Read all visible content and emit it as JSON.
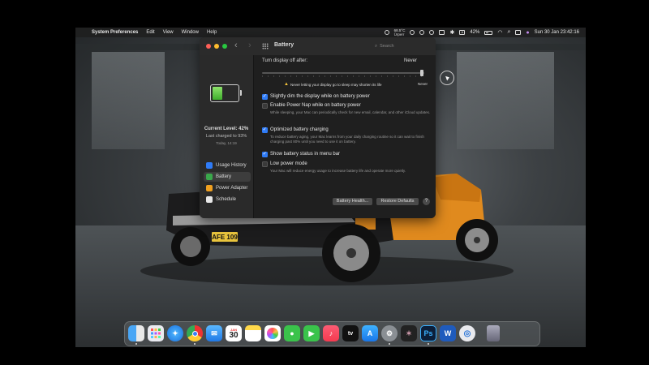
{
  "menubar": {
    "app_name": "System Preferences",
    "menus": [
      "Edit",
      "View",
      "Window",
      "Help"
    ],
    "temperature": "68.5°C",
    "temperature_sub": "Ürperr",
    "battery_percent": "42%",
    "clock": "Sun 30 Jan  23:42:16",
    "a_indicator": "A"
  },
  "window": {
    "title": "Battery",
    "search_placeholder": "Search"
  },
  "sidebar": {
    "level_label": "Current Level: 42%",
    "last_charged": "Last charged to 93%",
    "last_charged_time": "Today, 14:19",
    "battery_level": 0.42,
    "items": [
      {
        "label": "Usage History",
        "color": "#2f7bf6"
      },
      {
        "label": "Battery",
        "color": "#3aa84b"
      },
      {
        "label": "Power Adapter",
        "color": "#f0a020"
      },
      {
        "label": "Schedule",
        "color": "#e8e8e8"
      }
    ]
  },
  "content": {
    "slider_label": "Turn display off after:",
    "slider_value_top": "Never",
    "slider_value_bottom": "Never",
    "warning": "Never letting your display go to sleep may shorten its life",
    "options": [
      {
        "label": "Slightly dim the display while on battery power",
        "checked": true,
        "desc": ""
      },
      {
        "label": "Enable Power Nap while on battery power",
        "checked": false,
        "desc": "While sleeping, your Mac can periodically check for new email, calendar, and other iCloud updates."
      },
      {
        "label": "Optimized battery charging",
        "checked": true,
        "desc": "To reduce battery aging, your Mac learns from your daily charging routine so it can wait to finish charging past 80% until you need to use it on battery."
      },
      {
        "label": "Show battery status in menu bar",
        "checked": true,
        "desc": ""
      },
      {
        "label": "Low power mode",
        "checked": false,
        "desc": "Your Mac will reduce energy usage to increase battery life and operate more quietly."
      }
    ],
    "battery_health_button": "Battery Health...",
    "restore_defaults_button": "Restore Defaults",
    "help_button": "?"
  },
  "car": {
    "license_plate": "AFE 109",
    "body_color": "#e08a1e"
  },
  "dock": {
    "calendar_month": "JAN",
    "calendar_day": "30",
    "tv_label": "tv",
    "photoshop_label": "Ps",
    "word_label": "W"
  }
}
